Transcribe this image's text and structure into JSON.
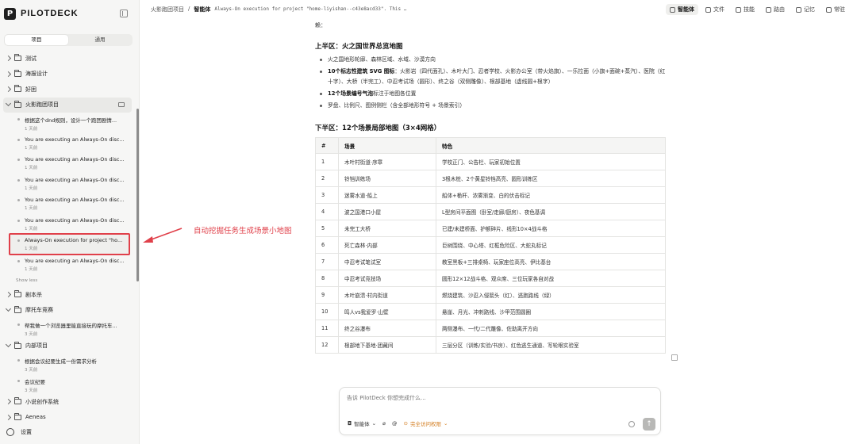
{
  "brand": {
    "logo_letter": "P",
    "name": "PILOTDECK"
  },
  "sidebar": {
    "tabs": [
      {
        "label": "项目",
        "active": true
      },
      {
        "label": "通用",
        "active": false
      }
    ],
    "folders_top": [
      {
        "label": "测试"
      },
      {
        "label": "海报设计"
      },
      {
        "label": "好困"
      }
    ],
    "active_folder": {
      "label": "火影跑团项目"
    },
    "sessions": [
      {
        "title": "根据这个dnd规则，设计一个跑团剧情...",
        "time": "1 天前"
      },
      {
        "title": "You are executing an Always-On disc...",
        "time": "1 天前"
      },
      {
        "title": "You are executing an Always-On disc...",
        "time": "1 天前"
      },
      {
        "title": "You are executing an Always-On disc...",
        "time": "1 天前"
      },
      {
        "title": "You are executing an Always-On disc...",
        "time": "1 天前"
      },
      {
        "title": "You are executing an Always-On disc...",
        "time": "1 天前"
      },
      {
        "title": "Always-On execution for project \"ho...",
        "time": "1 天前",
        "selected": true
      },
      {
        "title": "You are executing an Always-On disc...",
        "time": "1 天前"
      }
    ],
    "show_less": "Show less",
    "folder_jubensha": "剧本杀",
    "folder_moto": "摩托车竞赛",
    "moto_session": {
      "title": "帮我做一个浏览器里能直接玩的摩托车...",
      "time": "3 天前"
    },
    "folder_internal": "内部项目",
    "internal_sessions": [
      {
        "title": "根据会议纪要生成一份需求分析",
        "time": "3 天前"
      },
      {
        "title": "会议纪要",
        "time": "3 天前"
      }
    ],
    "folder_novel": "小说创作系统",
    "folder_aeneas": "Aeneas",
    "settings": "设置"
  },
  "annotation": {
    "text": "自动挖掘任务生成场景小地图",
    "color": "#e0404a"
  },
  "topbar": {
    "crumb_project": "火影跑团项目",
    "crumb_sep": "/",
    "crumb_agent": "智能体",
    "crumb_task": "Always-On execution for project \"home-liyishan--c43e8acd33\". This …",
    "tabs": [
      {
        "label": "智能体",
        "active": true
      },
      {
        "label": "文件"
      },
      {
        "label": "技能"
      },
      {
        "label": "路由"
      },
      {
        "label": "记忆"
      },
      {
        "label": "常驻"
      }
    ]
  },
  "doc": {
    "tail": "赖：",
    "section1_title": "上半区：火之国世界总览地图",
    "section1_items": [
      {
        "bold": "",
        "text": "火之国地形轮廓、森林区域、水域、沙漠方向"
      },
      {
        "bold": "10个标志性建筑 SVG 图标",
        "text": "：火影岩（四代面孔）、木叶大门、忍者学校、火影办公室（带火焰旗）、一乐拉面（小旗+面碗+蒸汽）、医院（红十字）、大桥（半完工）、中忍考试场（圆形）、终之谷（双侧雕像）、根部基地（虚线圆+根字）"
      },
      {
        "bold": "12个场景编号气泡",
        "text": "标注于地图各位置"
      },
      {
        "bold": "",
        "text": "罗盘、比例尺、图例侧栏（含全部地形符号 + 场景索引）"
      }
    ],
    "section2_title": "下半区：12个场景局部地图（3×4网格）",
    "table_headers": [
      "#",
      "场景",
      "特色"
    ],
    "table_rows": [
      [
        "1",
        "木叶村街道·序章",
        "学校正门、公告栏、玩家初始位置"
      ],
      [
        "2",
        "铃铛训练场",
        "3根木桩、2个黄星铃铛高亮、圆形训练区"
      ],
      [
        "3",
        "迷雾水道·船上",
        "船体+桅杆、浓雾渐变、白的伏击标记"
      ],
      [
        "4",
        "波之国港口小屋",
        "L型房间平面图（卧室/走廊/厨房）、夜色基调"
      ],
      [
        "5",
        "未完工大桥",
        "已建/未建桥面、护额碎片、线形10×4战斗格"
      ],
      [
        "6",
        "死亡森林·内部",
        "巨树围绕、中心塔、红框危险区、大蛇丸标记"
      ],
      [
        "7",
        "中忍考试笔试室",
        "教室黑板+三排桌椅、玩家座位高亮、伊比基台"
      ],
      [
        "8",
        "中忍考试竞技场",
        "圆形12×12战斗格、观众席、三位玩家各自对战"
      ],
      [
        "9",
        "木叶崩溃·村内街道",
        "燃烧建筑、沙忍入侵箭头（红）、逃跑路线（绿）"
      ],
      [
        "10",
        "鸣人vs我爱罗·山壁",
        "悬崖、月光、冲刺路线、沙甲范围圆圈"
      ],
      [
        "11",
        "终之谷瀑布",
        "两侧瀑布、一代/二代雕像、佐助离开方向"
      ],
      [
        "12",
        "根部地下基地·团藏间",
        "三层分区（训练/实验/书房）、红色逃生通道、写轮眼实验室"
      ]
    ]
  },
  "composer": {
    "placeholder": "告诉 PilotDeck 你想完成什么...",
    "agent_chip": "智能体",
    "permission_chip": "完全访问权限",
    "send_glyph": "↑"
  }
}
